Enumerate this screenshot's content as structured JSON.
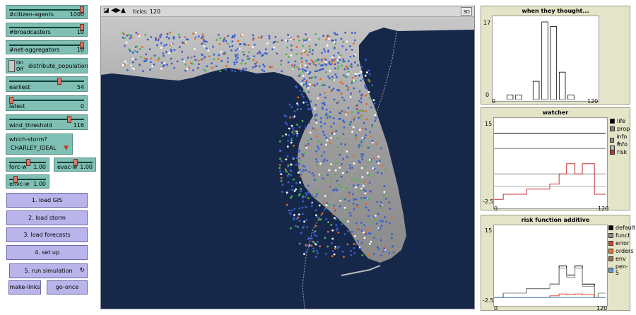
{
  "sliders": [
    {
      "label": "#citizen-agents",
      "value": "1000",
      "fraction": 1.0
    },
    {
      "label": "#broadcasters",
      "value": "10",
      "fraction": 1.0
    },
    {
      "label": "#net-aggregators",
      "value": "10",
      "fraction": 1.0
    },
    {
      "label": "earliest",
      "value": "54",
      "fraction": 0.6
    },
    {
      "label": "latest",
      "value": "0",
      "fraction": 0.0
    },
    {
      "label": "wind_threshold",
      "value": "116",
      "fraction": 0.75
    }
  ],
  "switch": {
    "on": "On",
    "off": "Off",
    "label": "distribute_population"
  },
  "chooser": {
    "label": "which-storm?",
    "value": "CHARLEY_IDEAL"
  },
  "weights": {
    "forc": {
      "label": "forc-w",
      "value": "1.00",
      "fraction": 0.5
    },
    "evac": {
      "label": "evac-w",
      "value": "1.00",
      "fraction": 0.5
    },
    "envc": {
      "label": "envc-w",
      "value": "1.00",
      "fraction": 0.5
    }
  },
  "buttons": [
    "1. load GIS",
    "2. load storm",
    "3. load forecasts",
    "4. set up",
    "5. run simulation"
  ],
  "small_buttons": [
    "make-links",
    "go-once"
  ],
  "forever_icon": "forever-icon",
  "view": {
    "ticks": "ticks: 120",
    "three_d": "3D",
    "toolbar_icons": [
      "shape-icon",
      "arrow-icons"
    ]
  },
  "plots": {
    "hist": {
      "title": "when they thought...",
      "ymax": "17",
      "ymin": "0",
      "xmin": "0",
      "xmax": "120",
      "chart_data": {
        "type": "bar",
        "categories": [
          10,
          20,
          30,
          40,
          50,
          60,
          70,
          80,
          90
        ],
        "values": [
          0,
          1,
          1,
          0,
          4,
          17,
          16,
          6,
          1
        ],
        "ylim": [
          0,
          17
        ],
        "xlim": [
          0,
          120
        ]
      }
    },
    "watcher": {
      "title": "watcher",
      "ymax": "15",
      "ymin": "-2.5",
      "xmin": "0",
      "xmax": "120",
      "legend": [
        {
          "name": "life",
          "color": "#000000"
        },
        {
          "name": "prop",
          "color": "#7f7f7f"
        },
        {
          "name": "info +",
          "color": "#8c8c8c"
        },
        {
          "name": "info -",
          "color": "#b4b4b4"
        },
        {
          "name": "risk",
          "color": "#c83232"
        }
      ],
      "chart_data": {
        "type": "line",
        "xlim": [
          0,
          120
        ],
        "ylim": [
          -2.5,
          15
        ],
        "series": [
          {
            "name": "life",
            "x": [
              0,
              120
            ],
            "y": [
              12,
              12
            ]
          },
          {
            "name": "prop",
            "x": [
              0,
              120
            ],
            "y": [
              9,
              9
            ]
          },
          {
            "name": "info +",
            "x": [
              0,
              120
            ],
            "y": [
              4,
              4
            ]
          },
          {
            "name": "info -",
            "x": [
              0,
              120
            ],
            "y": [
              1.5,
              1.5
            ]
          },
          {
            "name": "risk",
            "x": [
              0,
              10,
              10,
              35,
              35,
              60,
              60,
              70,
              70,
              78,
              78,
              87,
              87,
              95,
              95,
              108,
              108,
              112,
              112,
              120
            ],
            "y": [
              -1,
              -1,
              0,
              0,
              1,
              1,
              2,
              2,
              4,
              4,
              6,
              6,
              4,
              4,
              6,
              6,
              0,
              0,
              0,
              0
            ]
          }
        ]
      }
    },
    "risk": {
      "title": "risk function additive",
      "ymax": "15",
      "ymin": "-2.5",
      "xmin": "0",
      "xmax": "120",
      "legend": [
        {
          "name": "default",
          "color": "#000000"
        },
        {
          "name": "funct",
          "color": "#8c8c8c"
        },
        {
          "name": "error",
          "color": "#e03c28"
        },
        {
          "name": "orders",
          "color": "#f07020"
        },
        {
          "name": "env",
          "color": "#9d6e48"
        },
        {
          "name": "pen-5",
          "color": "#52a0d8"
        }
      ],
      "chart_data": {
        "type": "line",
        "xlim": [
          0,
          120
        ],
        "ylim": [
          -2.5,
          15
        ],
        "series": [
          {
            "name": "default",
            "x": [
              0,
              10,
              10,
              35,
              35,
              60,
              60,
              70,
              70,
              78,
              78,
              87,
              87,
              95,
              95,
              108,
              108,
              112,
              112,
              120
            ],
            "y": [
              -1,
              -1,
              0,
              0,
              1,
              1,
              2,
              2,
              6,
              6,
              4,
              4,
              6,
              6,
              2,
              2,
              -1,
              -1,
              0,
              0
            ]
          },
          {
            "name": "funct",
            "x": [
              0,
              10,
              10,
              35,
              35,
              60,
              60,
              70,
              70,
              78,
              78,
              87,
              87,
              95,
              95,
              108,
              108,
              112,
              112,
              120
            ],
            "y": [
              -1,
              -1,
              0,
              0,
              1,
              1,
              2,
              2,
              5.5,
              5.5,
              3.5,
              3.5,
              5.5,
              5.5,
              1.5,
              1.5,
              -1,
              -1,
              0,
              0
            ]
          },
          {
            "name": "error",
            "x": [
              0,
              60,
              60,
              70,
              70,
              78,
              78,
              87,
              87,
              95,
              95,
              108,
              108,
              120
            ],
            "y": [
              -1,
              -1,
              -0.6,
              -0.6,
              -0.2,
              -0.2,
              -0.4,
              -0.4,
              -0.2,
              -0.2,
              -0.4,
              -0.4,
              -1,
              -1
            ]
          },
          {
            "name": "pen-5",
            "x": [
              0,
              120
            ],
            "y": [
              -1,
              -1
            ]
          }
        ]
      }
    }
  }
}
